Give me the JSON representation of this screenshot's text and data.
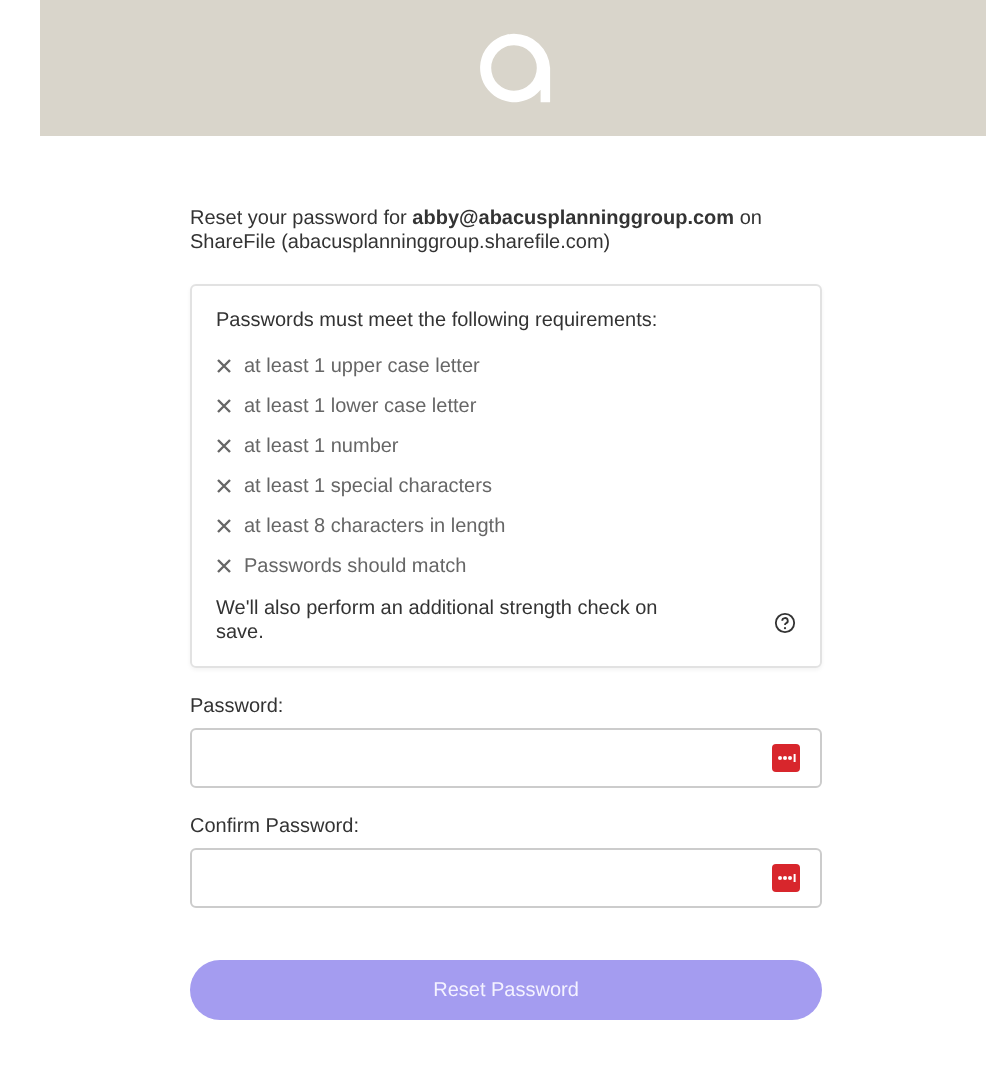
{
  "intro": "Reset your password for **abby@abacusplanninggroup.com** on ShareFile (abacusplanninggroup.sharefile.com)",
  "requirements": {
    "title": "Passwords must meet the following requirements:",
    "items": [
      {
        "text": "at least 1 upper case letter",
        "met": false
      },
      {
        "text": "at least 1 lower case letter",
        "met": false
      },
      {
        "text": "at least 1 number",
        "met": false
      },
      {
        "text": "at least 1 special characters",
        "met": false
      },
      {
        "text": "at least 8 characters in length",
        "met": false
      },
      {
        "text": "Passwords should match",
        "met": false
      }
    ],
    "note": "We'll also perform an additional strength check on save."
  },
  "fields": [
    {
      "label": "Password:"
    },
    {
      "label": "Confirm Password:"
    }
  ],
  "button": {
    "label": "Reset Password",
    "disabled": true
  }
}
